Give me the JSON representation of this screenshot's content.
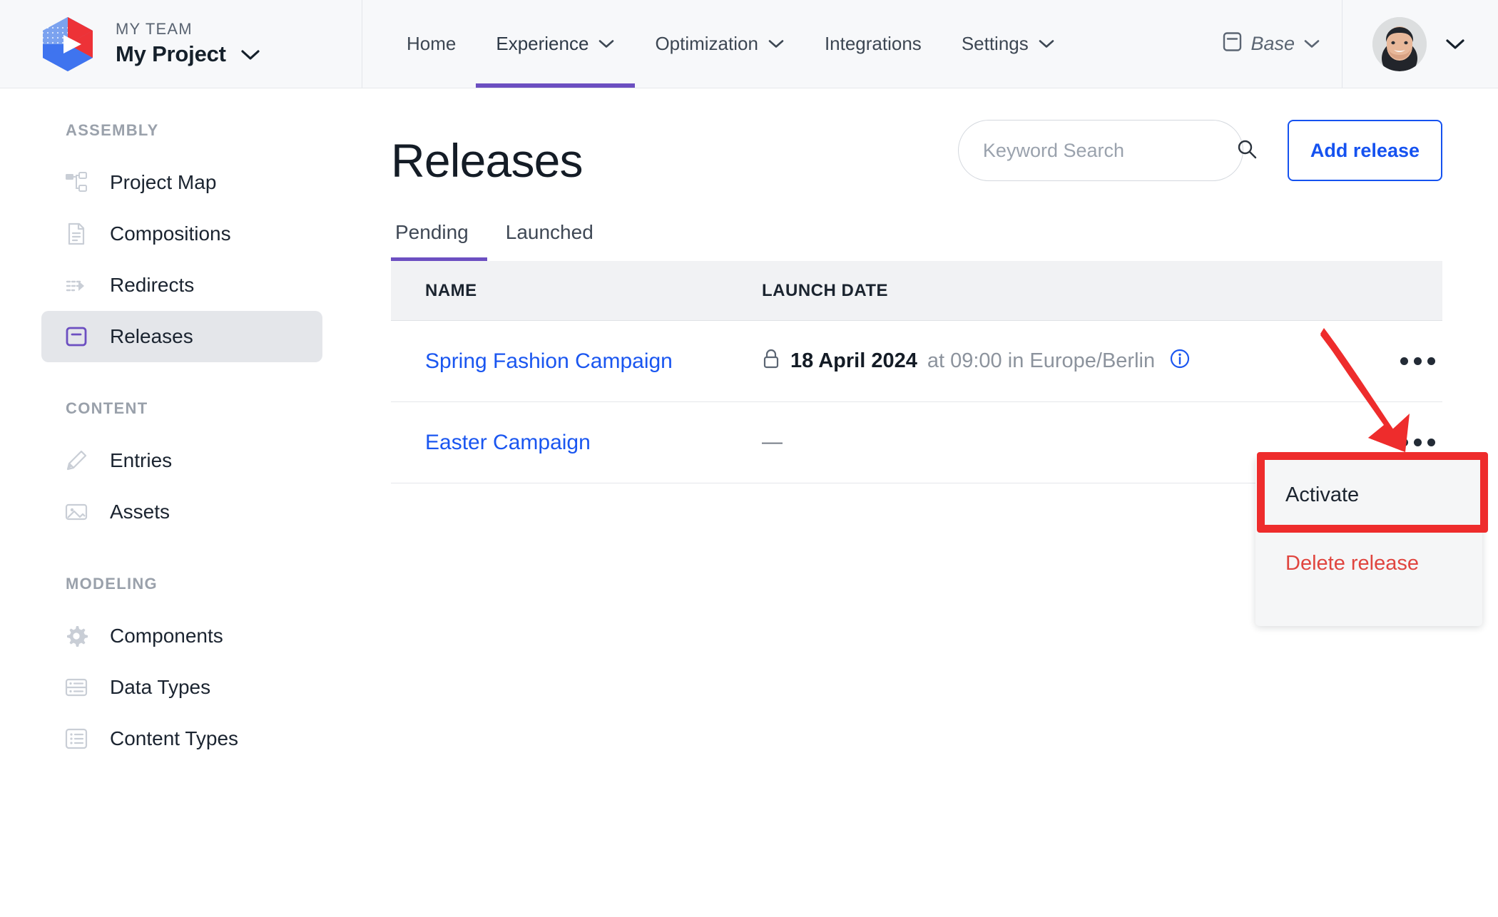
{
  "brand": {
    "team_label": "MY TEAM",
    "project_name": "My Project",
    "logo_icon": "uniform-hexagon-play-logo",
    "project_chevron_icon": "chevron-down-icon"
  },
  "topnav": {
    "items": [
      {
        "label": "Home",
        "has_chevron": false,
        "active": false
      },
      {
        "label": "Experience",
        "has_chevron": true,
        "active": true
      },
      {
        "label": "Optimization",
        "has_chevron": true,
        "active": false
      },
      {
        "label": "Integrations",
        "has_chevron": false,
        "active": false
      },
      {
        "label": "Settings",
        "has_chevron": true,
        "active": false
      }
    ],
    "base_chip": {
      "label": "Base",
      "icon": "device-frame-icon",
      "chevron": "chevron-down-icon"
    },
    "user": {
      "avatar_icon": "user-avatar-photo",
      "chevron": "chevron-down-icon"
    },
    "active_underline_color": "#6c4fc1"
  },
  "sidebar": {
    "sections": [
      {
        "heading": "ASSEMBLY",
        "items": [
          {
            "label": "Project Map",
            "icon": "sitemap-icon",
            "active": false
          },
          {
            "label": "Compositions",
            "icon": "document-lines-icon",
            "active": false
          },
          {
            "label": "Redirects",
            "icon": "arrow-redirect-icon",
            "active": false
          },
          {
            "label": "Releases",
            "icon": "release-window-icon",
            "active": true
          }
        ]
      },
      {
        "heading": "CONTENT",
        "items": [
          {
            "label": "Entries",
            "icon": "pencil-icon",
            "active": false
          },
          {
            "label": "Assets",
            "icon": "image-icon",
            "active": false
          }
        ]
      },
      {
        "heading": "MODELING",
        "items": [
          {
            "label": "Components",
            "icon": "gear-icon",
            "active": false
          },
          {
            "label": "Data Types",
            "icon": "data-rows-icon",
            "active": false
          },
          {
            "label": "Content Types",
            "icon": "list-icon",
            "active": false
          }
        ]
      }
    ],
    "active_icon_color": "#6c4fc1"
  },
  "page": {
    "title": "Releases",
    "search": {
      "placeholder": "Keyword Search",
      "value": "",
      "icon": "search-icon"
    },
    "add_button": {
      "label": "Add release",
      "color": "#1552f0"
    },
    "tabs": [
      {
        "label": "Pending",
        "active": true
      },
      {
        "label": "Launched",
        "active": false
      }
    ]
  },
  "table": {
    "columns": [
      "NAME",
      "LAUNCH DATE",
      ""
    ],
    "rows": [
      {
        "name": "Spring Fashion Campaign",
        "date_icon": "lock-icon",
        "date_strong": "18 April 2024",
        "date_rest": "at 09:00 in Europe/Berlin",
        "info_icon": "info-circle-icon",
        "actions_icon": "kebab-menu-icon"
      },
      {
        "name": "Easter Campaign",
        "date_icon": "",
        "date_strong": "",
        "date_rest": "—",
        "info_icon": "",
        "actions_icon": "kebab-menu-icon"
      }
    ]
  },
  "context_menu": {
    "items": [
      {
        "label": "Activate",
        "danger": false
      },
      {
        "label": "Delete release",
        "danger": true
      }
    ],
    "danger_color": "#e0453f"
  },
  "annotations": {
    "highlight_color": "#ee2c2c",
    "arrow_icon": "red-arrow-pointer",
    "box_icon": "red-highlight-box"
  }
}
